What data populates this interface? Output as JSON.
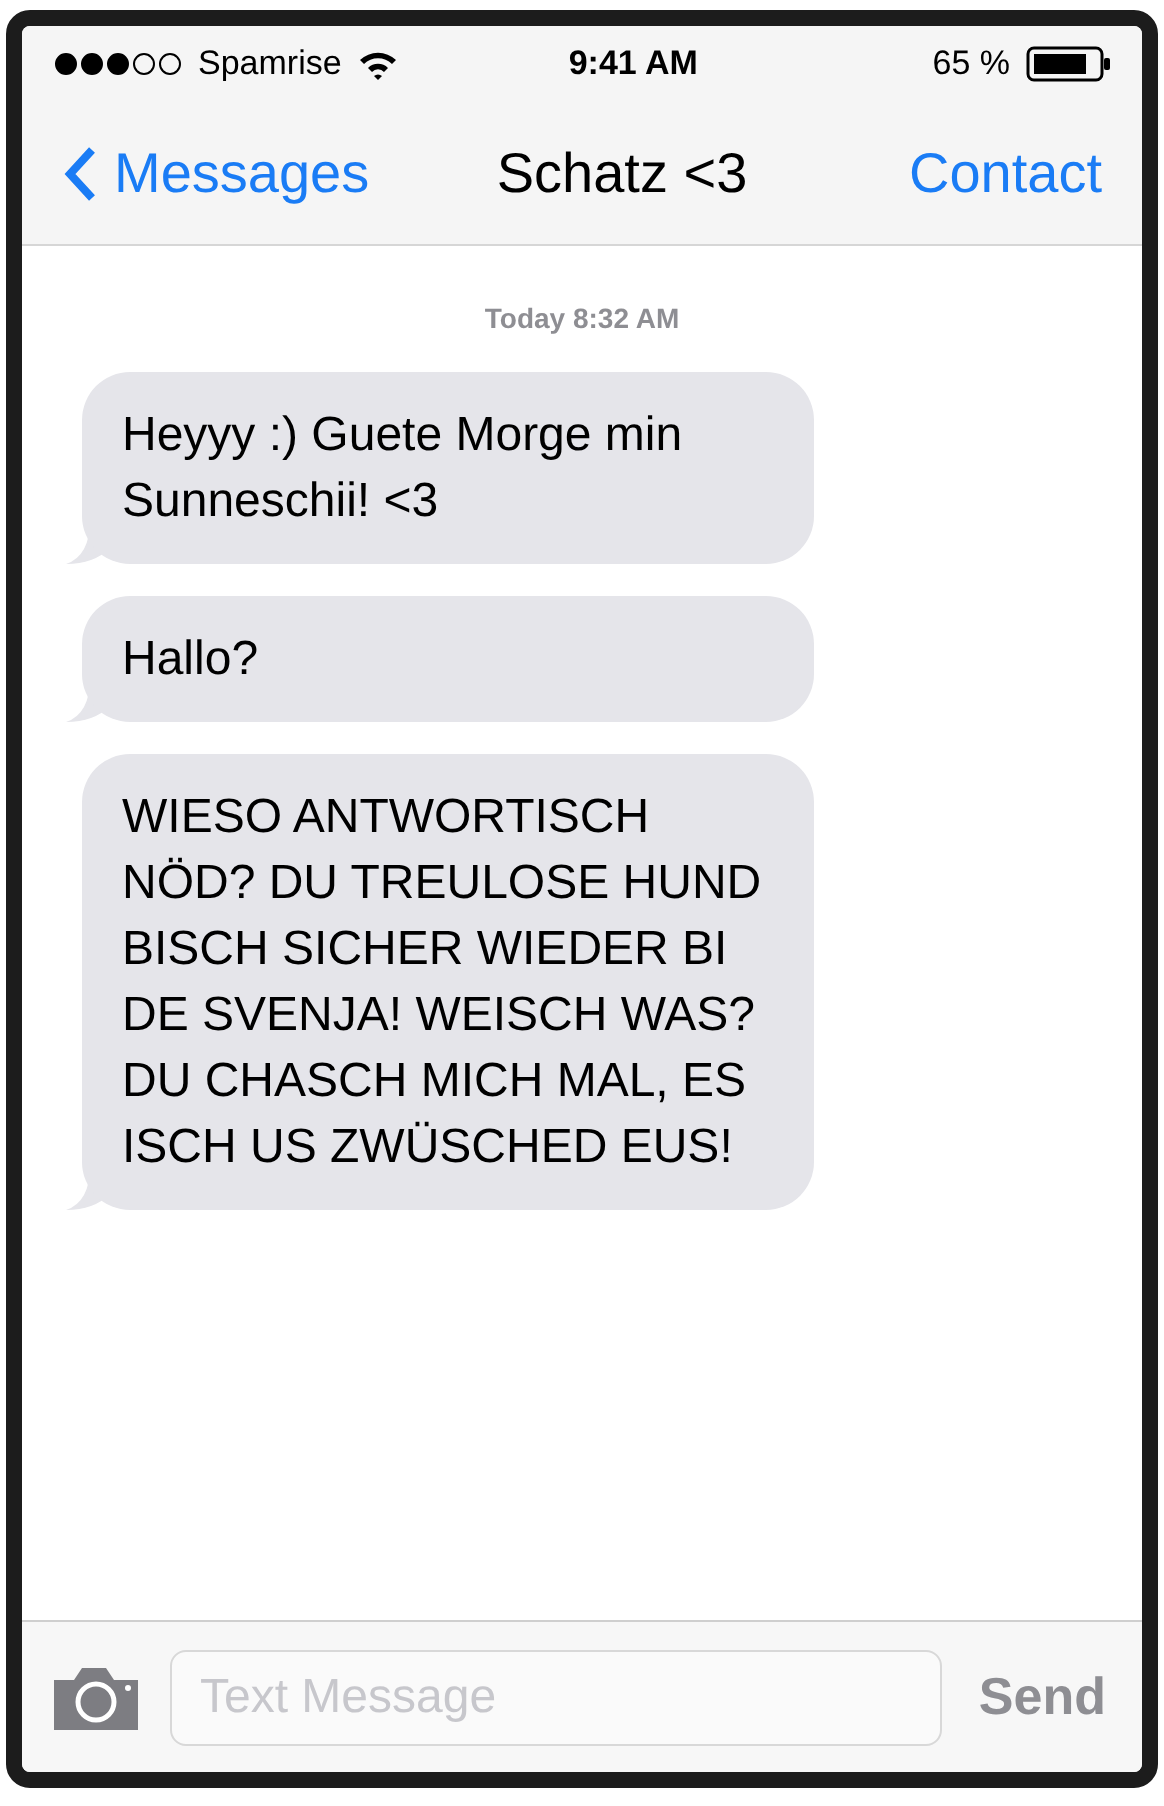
{
  "status_bar": {
    "carrier": "Spamrise",
    "time": "9:41 AM",
    "battery": "65 %"
  },
  "nav": {
    "back": "Messages",
    "title": "Schatz <3",
    "action": "Contact"
  },
  "timestamp": "Today 8:32 AM",
  "messages": [
    {
      "text": "Heyyy :) Guete Morge min Sunneschii! <3"
    },
    {
      "text": "Hallo?"
    },
    {
      "text": "WIESO ANTWORTISCH NÖD? DU TREULOSE HUND BISCH SICHER WIEDER BI DE SVENJA! WEISCH WAS? DU CHASCH MICH MAL, ES ISCH US ZWÜSCHED EUS!"
    }
  ],
  "composer": {
    "placeholder": "Text Message",
    "send": "Send"
  }
}
